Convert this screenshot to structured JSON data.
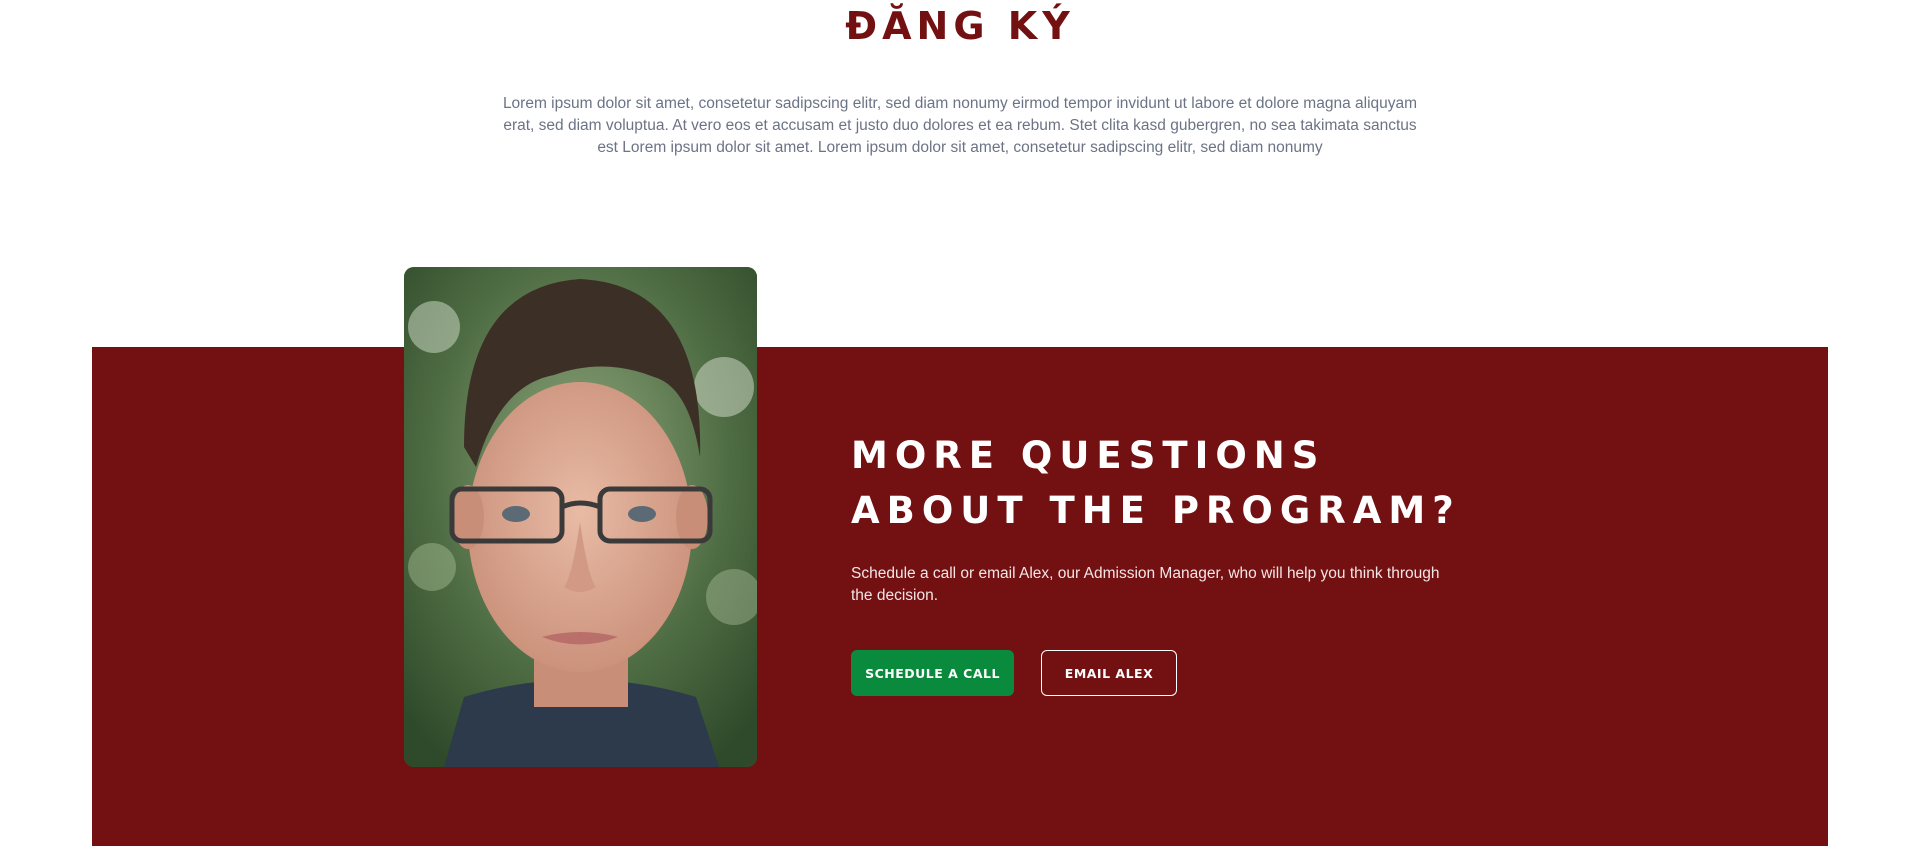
{
  "register_section": {
    "title": "ĐĂNG KÝ",
    "intro": "Lorem ipsum dolor sit amet, consetetur sadipscing elitr, sed diam nonumy eirmod tempor invidunt ut labore et dolore magna aliquyam erat, sed diam voluptua. At vero eos et accusam et justo duo dolores et ea rebum. Stet clita kasd gubergren, no sea takimata sanctus est Lorem ipsum dolor sit amet. Lorem ipsum dolor sit amet, consetetur sadipscing elitr, sed diam nonumy"
  },
  "cta": {
    "heading": "MORE QUESTIONS ABOUT THE PROGRAM?",
    "text": "Schedule a call or email Alex, our Admission Manager, who will help you think through the decision.",
    "primary_button": "SCHEDULE A CALL",
    "secondary_button": "EMAIL ALEX",
    "photo_subject": "admission-manager-photo"
  },
  "colors": {
    "brand_maroon": "#731012",
    "button_green": "#0a8a3c",
    "muted_text": "#6b7385",
    "white": "#ffffff"
  }
}
